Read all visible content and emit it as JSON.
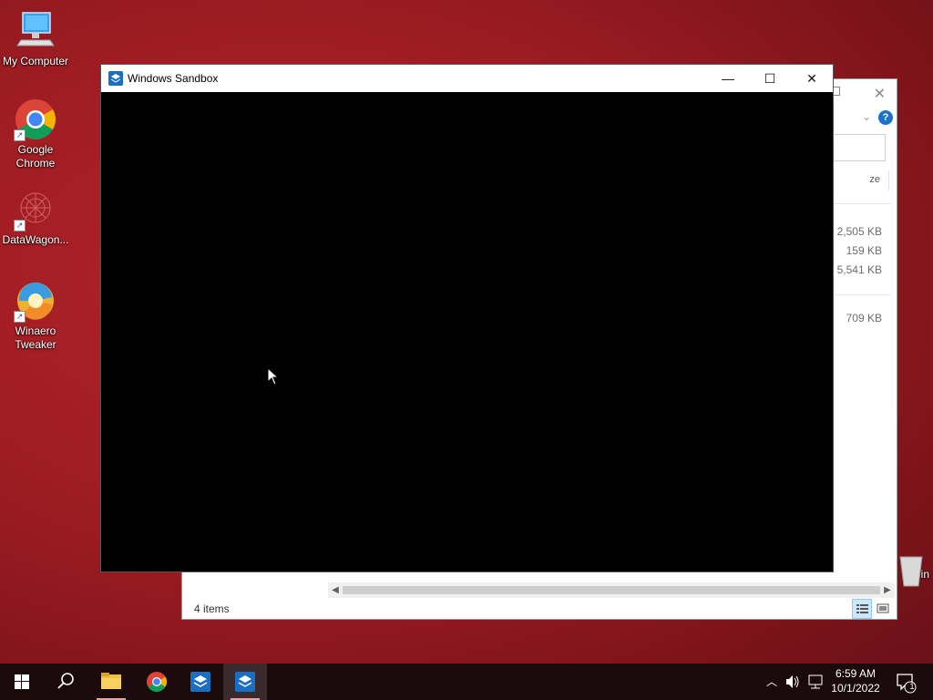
{
  "desktop": {
    "icons": [
      {
        "label": "My Computer",
        "icon": "computer-icon"
      },
      {
        "label": "Google Chrome",
        "icon": "chrome-icon"
      },
      {
        "label": "DataWagon...",
        "icon": "datawagon-icon"
      },
      {
        "label": "Winaero Tweaker",
        "icon": "winaero-icon"
      },
      {
        "label": "e Bin",
        "icon": "recycle-bin-icon"
      }
    ]
  },
  "explorer": {
    "column_header": "ze",
    "sizes": [
      "2,505 KB",
      "159 KB",
      "5,541 KB",
      "709 KB"
    ],
    "status": "4 items"
  },
  "sandbox": {
    "title": "Windows Sandbox",
    "minimize": "—",
    "maximize": "☐",
    "close": "✕"
  },
  "taskbar": {
    "items": [
      "start-icon",
      "search-icon",
      "file-explorer-icon",
      "chrome-icon",
      "sandbox-icon",
      "sandbox-icon"
    ],
    "time": "6:59 AM",
    "date": "10/1/2022",
    "notification_count": "1"
  },
  "colors": {
    "desktop_bg": "#9c1c22",
    "taskbar_bg": "#1b0a0b",
    "accent": "#1b6fc2"
  }
}
